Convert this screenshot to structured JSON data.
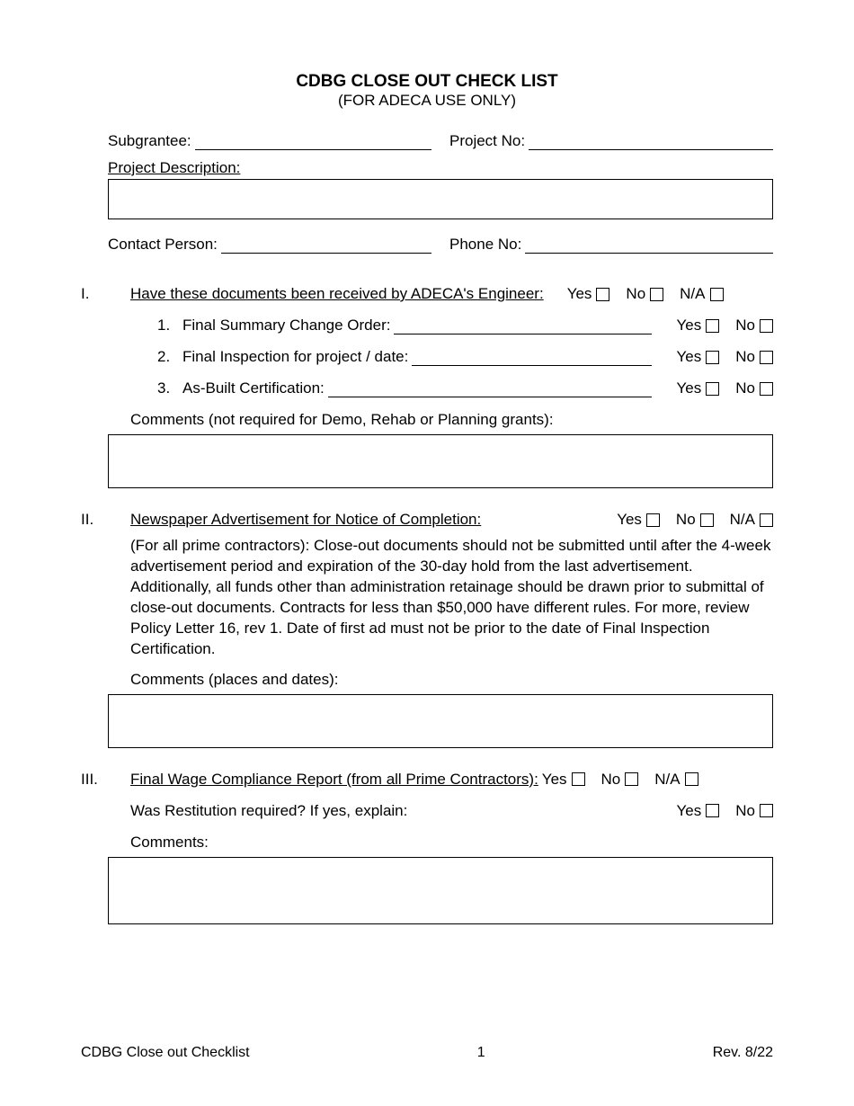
{
  "title": "CDBG CLOSE OUT CHECK LIST",
  "subtitle": "(FOR ADECA USE ONLY)",
  "fields": {
    "subgrantee": "Subgrantee:",
    "project_no": "Project No:",
    "project_desc": "Project Description:",
    "contact_person": "Contact Person:",
    "phone_no": "Phone No:"
  },
  "options": {
    "yes": "Yes",
    "no": "No",
    "na": "N/A"
  },
  "section1": {
    "roman": "I.",
    "heading": "Have these documents been received by ADECA's Engineer:",
    "items": [
      {
        "num": "1.",
        "label": "Final Summary Change Order:"
      },
      {
        "num": "2.",
        "label": "Final Inspection for project / date:"
      },
      {
        "num": "3.",
        "label": "As-Built Certification:"
      }
    ],
    "comments_label": "Comments (not required for Demo, Rehab or Planning grants):"
  },
  "section2": {
    "roman": "II.",
    "heading": "Newspaper Advertisement for Notice of Completion:",
    "para": "(For all prime contractors): Close-out documents should not be submitted until after the 4-week advertisement period and expiration of the 30-day hold from the last advertisement. Additionally, all funds other than administration retainage should be drawn prior to submittal of close-out documents. Contracts for less than $50,000 have different rules. For more, review Policy Letter 16, rev 1. Date of first ad must not be prior to the date of Final Inspection Certification.",
    "comments_label": "Comments (places and dates):"
  },
  "section3": {
    "roman": "III.",
    "heading": "Final Wage Compliance Report (from all Prime Contractors):",
    "restitution": "Was Restitution required? If yes, explain:",
    "comments_label": "Comments:"
  },
  "footer": {
    "left": "CDBG Close out Checklist",
    "center": "1",
    "right": "Rev. 8/22"
  }
}
